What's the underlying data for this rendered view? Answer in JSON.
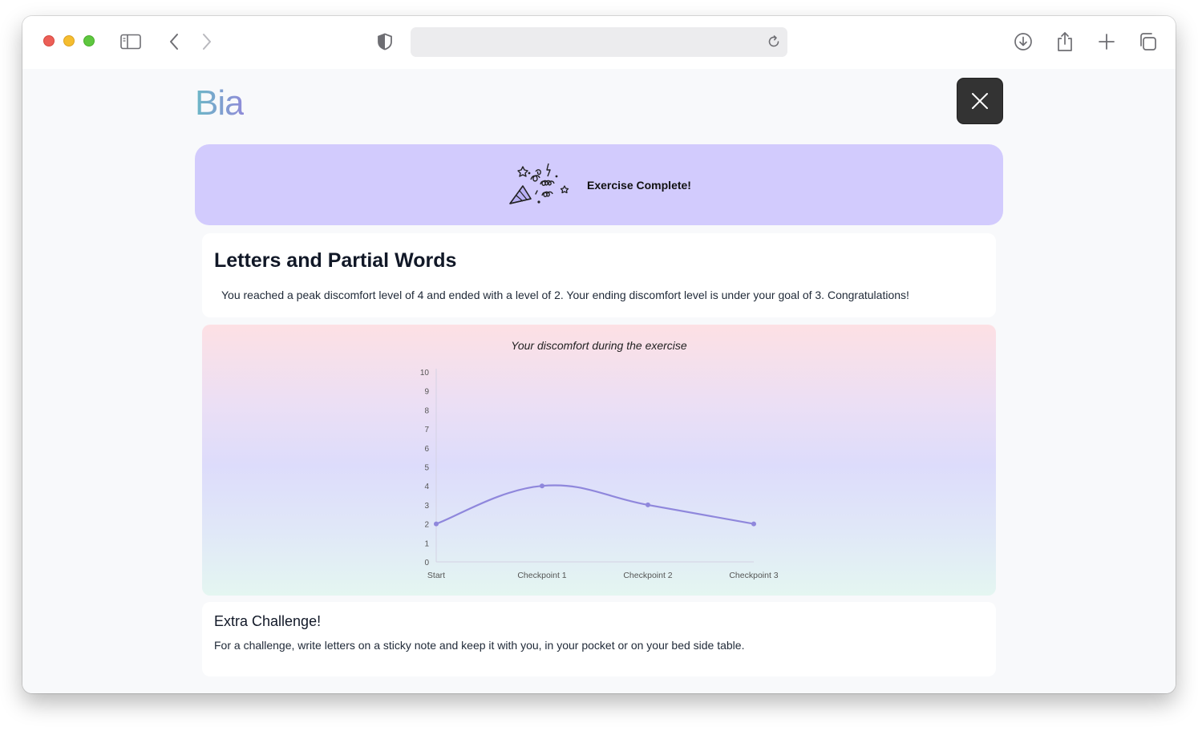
{
  "browser": {
    "address_value": "",
    "icons": [
      "sidebar-icon",
      "back-icon",
      "forward-icon",
      "shield-icon",
      "reload-icon",
      "download-icon",
      "share-icon",
      "new-tab-icon",
      "tabs-overview-icon"
    ]
  },
  "app": {
    "logo": "Bia",
    "close_icon": "close-icon"
  },
  "banner": {
    "icon": "party-popper-icon",
    "text": "Exercise Complete!",
    "color": "#d2cbfd"
  },
  "summary": {
    "title": "Letters and Partial Words",
    "message": "You reached a peak discomfort level of 4 and ended with a level of 2. Your ending discomfort level is under your goal of 3. Congratulations!"
  },
  "chart_data": {
    "type": "line",
    "title": "Your discomfort during the exercise",
    "categories": [
      "Start",
      "Checkpoint 1",
      "Checkpoint 2",
      "Checkpoint 3"
    ],
    "values": [
      2,
      4,
      3,
      2
    ],
    "yticks": [
      "0",
      "1",
      "2",
      "3",
      "4",
      "5",
      "6",
      "7",
      "8",
      "9",
      "10"
    ],
    "ylim": [
      0,
      10
    ],
    "xlabel": "",
    "ylabel": "",
    "grid": false,
    "line_color": "#8f87dc"
  },
  "extra": {
    "title": "Extra Challenge!",
    "text": "For a challenge, write letters on a sticky note and keep it with you, in your pocket or on your bed side table."
  }
}
